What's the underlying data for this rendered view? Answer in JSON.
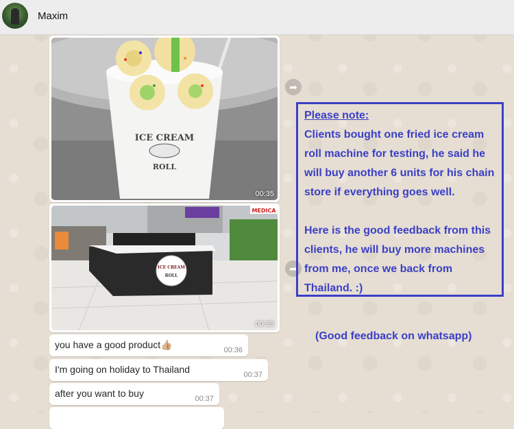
{
  "contact": {
    "name": "Maxim"
  },
  "messages": [
    {
      "type": "image",
      "description": "ice cream rolls in a cup",
      "time": "00:35"
    },
    {
      "type": "image",
      "description": "ice cream kiosk in a mall",
      "time": "00:35"
    },
    {
      "type": "text",
      "text": "you have a good product👍🏼",
      "time": "00:36"
    },
    {
      "type": "text",
      "text": "I'm going on holiday to Thailand",
      "time": "00:37"
    },
    {
      "type": "text",
      "text": "after you want to buy",
      "time": "00:37"
    }
  ],
  "annotation": {
    "heading": "Please note:",
    "paragraph1": "Clients bought one fried ice cream roll machine for testing, he said he will buy another 6 units for his chain store if everything goes well.",
    "paragraph2": "Here is the good feedback from this clients, he will buy more machines from me, once we back from Thailand.  :)",
    "caption": "(Good feedback on whatsapp)",
    "color": "#3a3fc6"
  },
  "cup_print": {
    "line1": "ICE CREAM",
    "line2": "ROLL"
  },
  "kiosk_sign": {
    "line1": "ICE CREAM",
    "line2": "ROLL"
  },
  "shop_sign": "MEDICA",
  "icons": {
    "forward": "forward-arrow-icon"
  }
}
